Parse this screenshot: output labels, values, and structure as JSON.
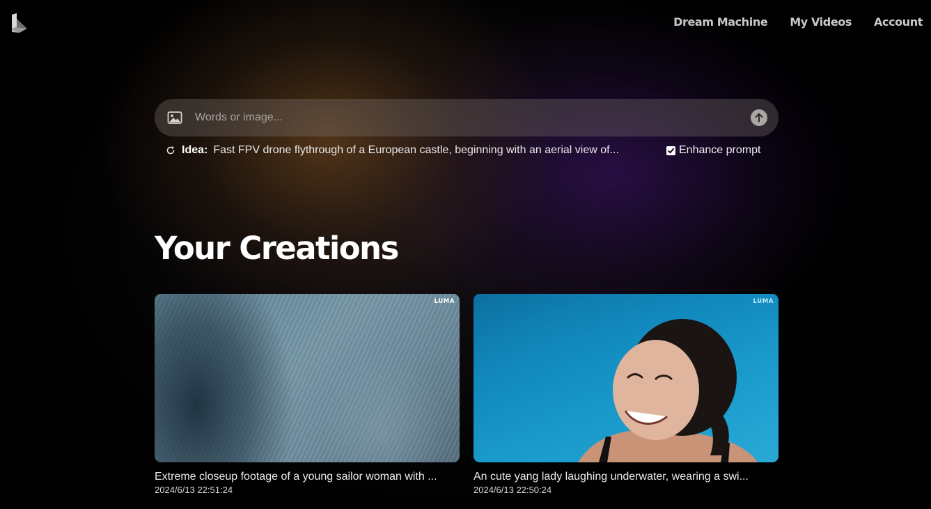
{
  "header": {
    "logo_icon": "luma-logo-icon",
    "nav": [
      {
        "label": "Dream Machine"
      },
      {
        "label": "My Videos"
      },
      {
        "label": "Account"
      }
    ]
  },
  "prompt": {
    "image_icon": "image-icon",
    "placeholder": "Words or image...",
    "value": "",
    "submit_icon": "arrow-up-icon"
  },
  "idea": {
    "refresh_icon": "refresh-icon",
    "label": "Idea:",
    "text": "Fast FPV drone flythrough of a European castle, beginning with an aerial view of..."
  },
  "enhance": {
    "label": "Enhance prompt",
    "checked": true
  },
  "section": {
    "title": "Your Creations"
  },
  "creations": [
    {
      "badge": "LUMA",
      "caption": "Extreme closeup footage of a young sailor woman with ...",
      "date": "2024/6/13 22:51:24"
    },
    {
      "badge": "LUMA",
      "caption": "An cute yang lady laughing underwater, wearing a swi...",
      "date": "2024/6/13 22:50:24"
    }
  ],
  "colors": {
    "background": "#000000",
    "nav_text": "#c9c9c9",
    "prompt_bar": "#827a76",
    "submit_button": "#a9a6a4"
  }
}
